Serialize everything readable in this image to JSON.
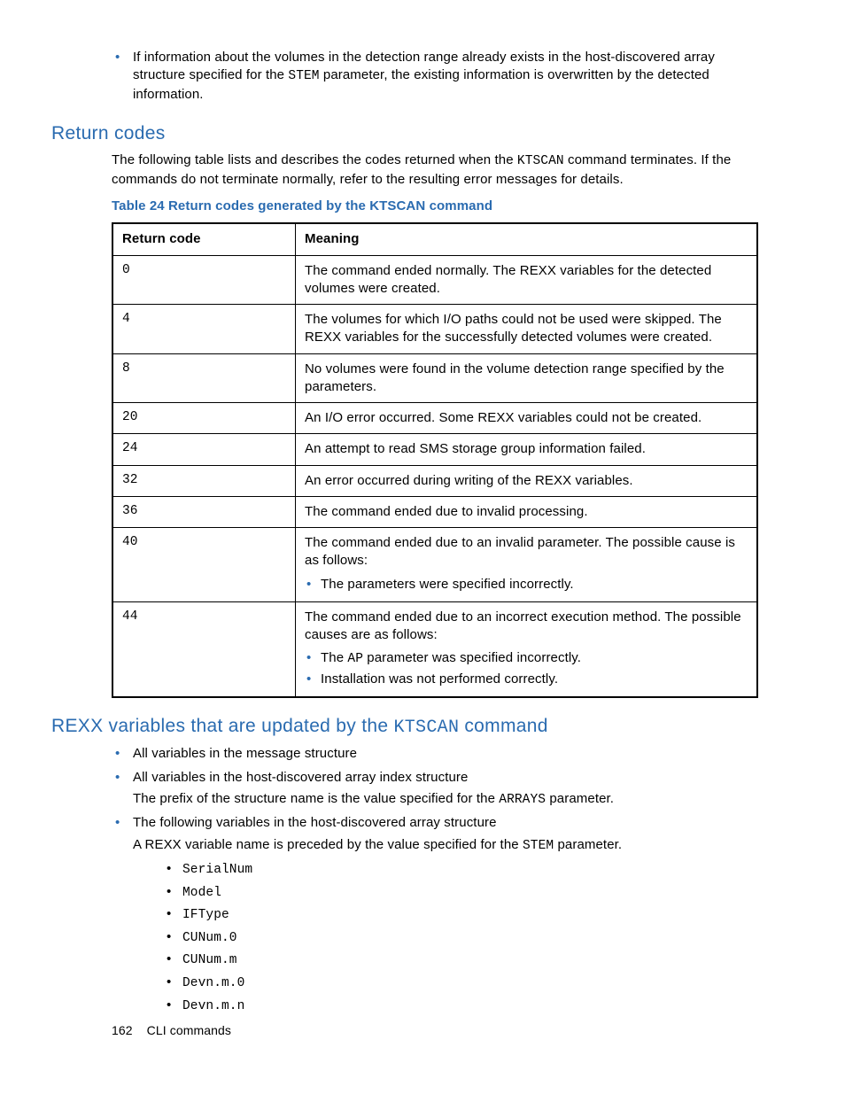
{
  "intro_bullet": {
    "t1": "If information about the volumes in the detection range already exists in the host-discovered array structure specified for the ",
    "param": "STEM",
    "t2": " parameter, the existing information is overwritten by the detected information."
  },
  "section_return": {
    "heading": "Return codes",
    "para_t1": "The following table lists and describes the codes returned when the ",
    "para_cmd": "KTSCAN",
    "para_t2": " command terminates. If the commands do not terminate normally, refer to the resulting error messages for details.",
    "caption": "Table 24 Return codes generated by the KTSCAN command",
    "headers": {
      "code": "Return code",
      "meaning": "Meaning"
    },
    "rows": [
      {
        "code": "0",
        "meaning": "The command ended normally. The REXX variables for the detected volumes were created."
      },
      {
        "code": "4",
        "meaning": "The volumes for which I/O paths could not be used were skipped. The REXX variables for the successfully detected volumes were created."
      },
      {
        "code": "8",
        "meaning": "No volumes were found in the volume detection range specified by the parameters."
      },
      {
        "code": "20",
        "meaning": "An I/O error occurred. Some REXX variables could not be created."
      },
      {
        "code": "24",
        "meaning": "An attempt to read SMS storage group information failed."
      },
      {
        "code": "32",
        "meaning": "An error occurred during writing of the REXX variables."
      },
      {
        "code": "36",
        "meaning": "The command ended due to invalid processing."
      },
      {
        "code": "40",
        "meaning": "The command ended due to an invalid parameter. The possible cause is as follows:",
        "sub": [
          "The parameters were specified incorrectly."
        ]
      },
      {
        "code": "44",
        "meaning": "The command ended due to an incorrect execution method. The possible causes are as follows:",
        "sub_parts": [
          {
            "pre": "The ",
            "mono": "AP",
            "post": " parameter was specified incorrectly."
          },
          {
            "pre": "Installation was not performed correctly.",
            "mono": "",
            "post": ""
          }
        ]
      }
    ]
  },
  "section_rexx": {
    "heading_t1": "REXX variables that are updated by the ",
    "heading_cmd": "KTSCAN",
    "heading_t2": " command",
    "items": [
      {
        "text": "All variables in the message structure"
      },
      {
        "text": "All variables in the host-discovered array index structure",
        "sub_t1": "The prefix of the structure name is the value specified for the ",
        "sub_mono": "ARRAYS",
        "sub_t2": " parameter."
      },
      {
        "text": "The following variables in the host-discovered array structure",
        "sub_t1": "A REXX variable name is preceded by the value specified for the ",
        "sub_mono": "STEM",
        "sub_t2": " parameter.",
        "vars": [
          "SerialNum",
          "Model",
          "IFType",
          "CUNum.0",
          "CUNum.m",
          "Devn.m.0",
          "Devn.m.n"
        ]
      }
    ]
  },
  "footer": {
    "page": "162",
    "section": "CLI commands"
  }
}
